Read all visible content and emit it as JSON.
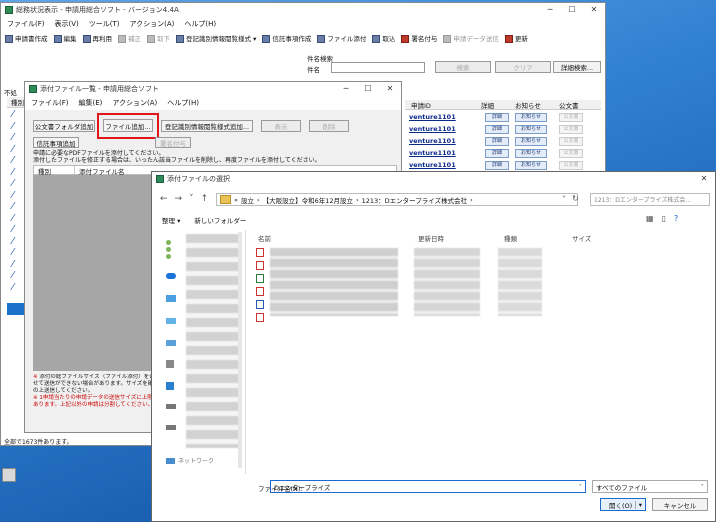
{
  "main_window": {
    "title": "総務状況表示 - 申請用総合ソフト - バージョン4.4A",
    "menu": [
      "ファイル(F)",
      "表示(V)",
      "ツール(T)",
      "アクション(A)",
      "ヘルプ(H)"
    ],
    "toolbar": [
      "申請書作成",
      "編集",
      "再利用",
      "補正",
      "取下",
      "登記識別情報閲覧様式",
      "信託事項作成",
      "ファイル添付",
      "取込",
      "署名付与",
      "申請データ送信",
      "更新"
    ],
    "search_label": "件名検索",
    "subject_label": "件名",
    "search_button": "検索",
    "clear_button": "クリア",
    "detail_search_button": "詳細検索...",
    "left_label": "不処",
    "col_header": "種別",
    "columns": [
      "申請ID",
      "詳細",
      "お知らせ",
      "公文書"
    ],
    "rows": [
      {
        "id": "venture1101",
        "detail": "詳細",
        "notice": "お知らせ",
        "doc": "公文書"
      },
      {
        "id": "venture1101",
        "detail": "詳細",
        "notice": "お知らせ",
        "doc": "公文書"
      },
      {
        "id": "venture1101",
        "detail": "詳細",
        "notice": "お知らせ",
        "doc": "公文書"
      },
      {
        "id": "venture1101",
        "detail": "詳細",
        "notice": "お知らせ",
        "doc": "公文書"
      },
      {
        "id": "venture1101",
        "detail": "詳細",
        "notice": "お知らせ",
        "doc": "公文書"
      }
    ],
    "status": "全部で1673件あります。"
  },
  "attach_window": {
    "title": "添付ファイル一覧 - 申請用総合ソフト",
    "menu": [
      "ファイル(F)",
      "編集(E)",
      "アクション(A)",
      "ヘルプ(H)"
    ],
    "btn_pubdoc": "公文書フォルダ追加",
    "btn_file_add": "ファイル追加...",
    "btn_register": "登記識別情報閲覧様式追加...",
    "btn_show": "表示",
    "btn_delete": "削除",
    "btn_trust": "信託事項追加",
    "btn_sign": "署名付与",
    "notice1": "申請に必要なPDFファイルを添付してください。",
    "notice2": "添付したファイルを修正する場合は、いったん該当ファイルを削除し、再度ファイルを添付してください。",
    "col_type": "種別",
    "col_filename": "添付ファイル名",
    "warn1": "添付の総ファイルサイズ（ファイル添付）を合わせて送信ができない場合があります。サイズを確認の上送信してください。",
    "warn2": "1申請当たりの申請データの送信サイズに上限があります。上記以外の申請は分割してください。"
  },
  "file_dialog": {
    "title": "添付ファイルの選択",
    "path": [
      "設立",
      "【大阪設立】令和6年12月設立",
      "1213：Dエンタープライズ株式会社"
    ],
    "path_prefix": "«",
    "search_placeholder": "1213：Dエンタープライズ株式会...",
    "organize": "整理",
    "new_folder": "新しいフォルダー",
    "columns": [
      "名前",
      "更新日時",
      "種類",
      "サイズ"
    ],
    "filename_label": "ファイル名(N):",
    "filename_value": "Dエンタープライズ",
    "filetype_value": "すべてのファイル",
    "open_button": "開く(O)",
    "cancel_button": "キャンセル",
    "nav_bottom": "ネットワーク"
  },
  "taskbar_icon_label": ""
}
